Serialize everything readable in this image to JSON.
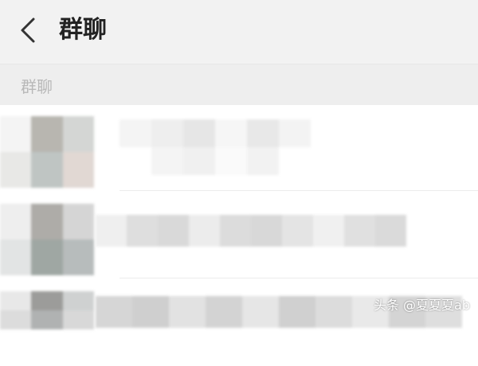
{
  "nav": {
    "title": "群聊",
    "back_icon": "chevron-left-icon"
  },
  "section": {
    "label": "群聊"
  },
  "colors": {
    "nav_bg": "#f2f2f2",
    "section_bg": "#eeeeee",
    "title": "#222222",
    "section_label": "#b8b8b8"
  },
  "watermark": "头条 @夏夏夏ab"
}
